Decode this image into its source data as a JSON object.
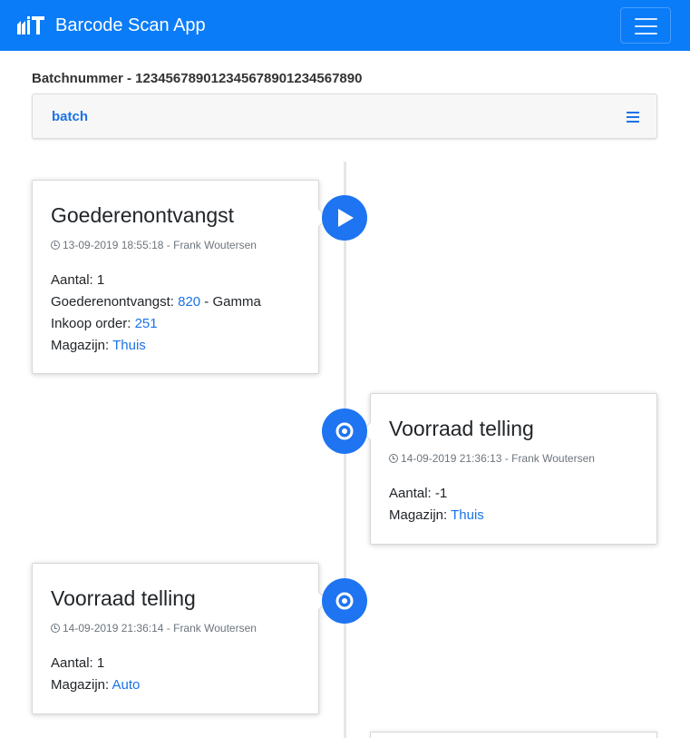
{
  "navbar": {
    "brand": "Barcode Scan App",
    "logo_icon": "factory-logo-icon",
    "menu_icon": "hamburger-icon",
    "color": "#0a7cf8"
  },
  "batch": {
    "title": "Batchnummer - 123456789012345678901234567890",
    "panel_label": "batch",
    "menu_icon": "list-icon"
  },
  "timeline": [
    {
      "title": "Goederenontvangst",
      "timestamp": "13-09-2019 18:55:18",
      "separator": " - ",
      "user": "Frank Woutersen",
      "icon": "play-icon",
      "aantal_label": "Aantal:",
      "aantal_value": "1",
      "ontvangst_label": "Goederenontvangst:",
      "ontvangst_link": "820",
      "ontvangst_suffix": " - Gamma",
      "order_label": "Inkoop order:",
      "order_link": "251",
      "magazijn_label": "Magazijn:",
      "magazijn_link": "Thuis"
    },
    {
      "title": "Voorraad telling",
      "timestamp": "14-09-2019 21:36:13",
      "separator": " - ",
      "user": "Frank Woutersen",
      "icon": "target-icon",
      "aantal_label": "Aantal:",
      "aantal_value": "-1",
      "magazijn_label": "Magazijn:",
      "magazijn_link": "Thuis"
    },
    {
      "title": "Voorraad telling",
      "timestamp": "14-09-2019 21:36:14",
      "separator": " - ",
      "user": "Frank Woutersen",
      "icon": "target-icon",
      "aantal_label": "Aantal:",
      "aantal_value": "1",
      "magazijn_label": "Magazijn:",
      "magazijn_link": "Auto"
    }
  ],
  "colors": {
    "accent": "#1e74f1",
    "link": "#1a73e8",
    "muted": "#6c757d"
  }
}
